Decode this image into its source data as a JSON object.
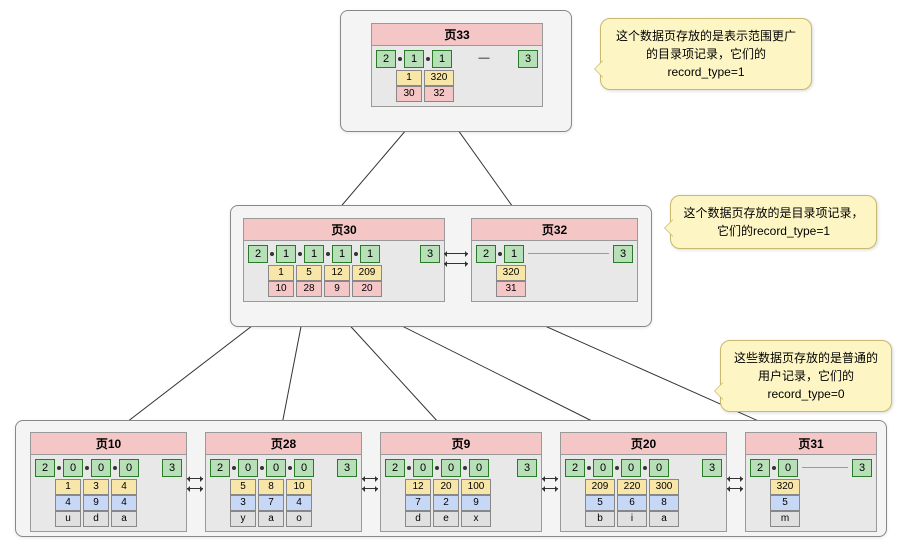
{
  "callouts": {
    "c1": "这个数据页存放的是表示范围更广的目录项记录，它们的record_type=1",
    "c2": "这个数据页存放的是目录项记录，它们的record_type=1",
    "c3": "这些数据页存放的是普通的用户记录，它们的record_type=0"
  },
  "pages": {
    "p33": {
      "title": "页33",
      "header": [
        "2",
        "1",
        "1",
        "3"
      ],
      "entries": [
        {
          "key": "1",
          "ptr": "30"
        },
        {
          "key": "320",
          "ptr": "32"
        }
      ]
    },
    "p30": {
      "title": "页30",
      "header": [
        "2",
        "1",
        "1",
        "1",
        "1",
        "3"
      ],
      "entries": [
        {
          "key": "1",
          "ptr": "10"
        },
        {
          "key": "5",
          "ptr": "28"
        },
        {
          "key": "12",
          "ptr": "9"
        },
        {
          "key": "209",
          "ptr": "20"
        }
      ]
    },
    "p32": {
      "title": "页32",
      "header": [
        "2",
        "1",
        "3"
      ],
      "entries": [
        {
          "key": "320",
          "ptr": "31"
        }
      ]
    },
    "p10": {
      "title": "页10",
      "header": [
        "2",
        "0",
        "0",
        "0",
        "3"
      ],
      "entries": [
        {
          "key": "1",
          "val": "4",
          "chr": "u"
        },
        {
          "key": "3",
          "val": "9",
          "chr": "d"
        },
        {
          "key": "4",
          "val": "4",
          "chr": "a"
        }
      ]
    },
    "p28": {
      "title": "页28",
      "header": [
        "2",
        "0",
        "0",
        "0",
        "3"
      ],
      "entries": [
        {
          "key": "5",
          "val": "3",
          "chr": "y"
        },
        {
          "key": "8",
          "val": "7",
          "chr": "a"
        },
        {
          "key": "10",
          "val": "4",
          "chr": "o"
        }
      ]
    },
    "p9": {
      "title": "页9",
      "header": [
        "2",
        "0",
        "0",
        "0",
        "3"
      ],
      "entries": [
        {
          "key": "12",
          "val": "7",
          "chr": "d"
        },
        {
          "key": "20",
          "val": "2",
          "chr": "e"
        },
        {
          "key": "100",
          "val": "9",
          "chr": "x"
        }
      ]
    },
    "p20": {
      "title": "页20",
      "header": [
        "2",
        "0",
        "0",
        "0",
        "3"
      ],
      "entries": [
        {
          "key": "209",
          "val": "5",
          "chr": "b"
        },
        {
          "key": "220",
          "val": "6",
          "chr": "i"
        },
        {
          "key": "300",
          "val": "8",
          "chr": "a"
        }
      ]
    },
    "p31": {
      "title": "页31",
      "header": [
        "2",
        "0",
        "3"
      ],
      "entries": [
        {
          "key": "320",
          "val": "5",
          "chr": "m"
        }
      ]
    }
  }
}
